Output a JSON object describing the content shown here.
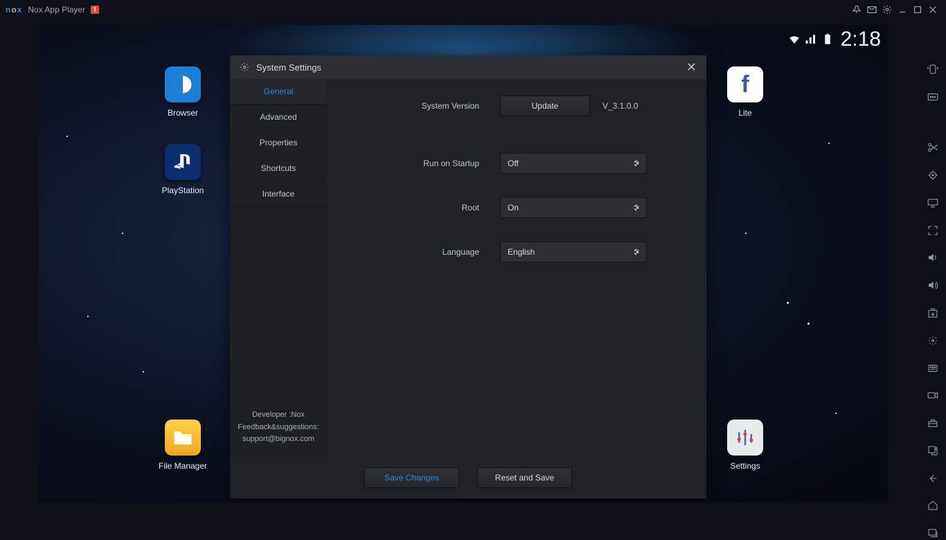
{
  "window": {
    "title": "Nox App Player"
  },
  "statusbar": {
    "time": "2:18"
  },
  "desktop": {
    "browser": "Browser",
    "playstation": "PlayStation",
    "filemanager": "File Manager",
    "lite": "Lite",
    "settings": "Settings"
  },
  "dialog": {
    "title": "System Settings",
    "tabs": {
      "general": "General",
      "advanced": "Advanced",
      "properties": "Properties",
      "shortcuts": "Shortcuts",
      "interface": "Interface"
    },
    "dev_line1": "Developer :Nox",
    "dev_line2": "Feedback&suggestions:",
    "dev_line3": "support@bignox.com",
    "rows": {
      "version_label": "System Version",
      "update_btn": "Update",
      "version_value": "V_3.1.0.0",
      "startup_label": "Run on Startup",
      "startup_value": "Off",
      "root_label": "Root",
      "root_value": "On",
      "language_label": "Language",
      "language_value": "English"
    },
    "footer": {
      "save": "Save Changes",
      "reset": "Reset and Save"
    }
  }
}
